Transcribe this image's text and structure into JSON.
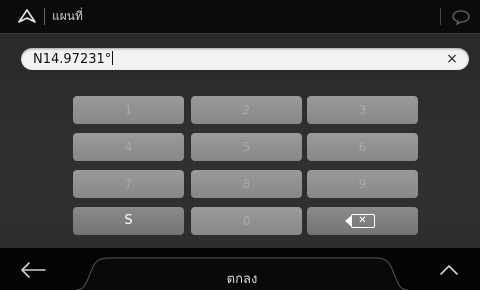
{
  "header": {
    "title": "แผนที่"
  },
  "input": {
    "value": "N14.97231°",
    "clear_icon": "×"
  },
  "keypad": {
    "rows": [
      [
        "1",
        "2",
        "3"
      ],
      [
        "4",
        "5",
        "6"
      ],
      [
        "7",
        "8",
        "9"
      ]
    ],
    "s_key": "S",
    "zero_key": "0"
  },
  "footer": {
    "ok_label": "ตกลง"
  },
  "colors": {
    "accent": "#ffffff",
    "key": "#8a8a8a",
    "background": "#2e2e2e"
  }
}
